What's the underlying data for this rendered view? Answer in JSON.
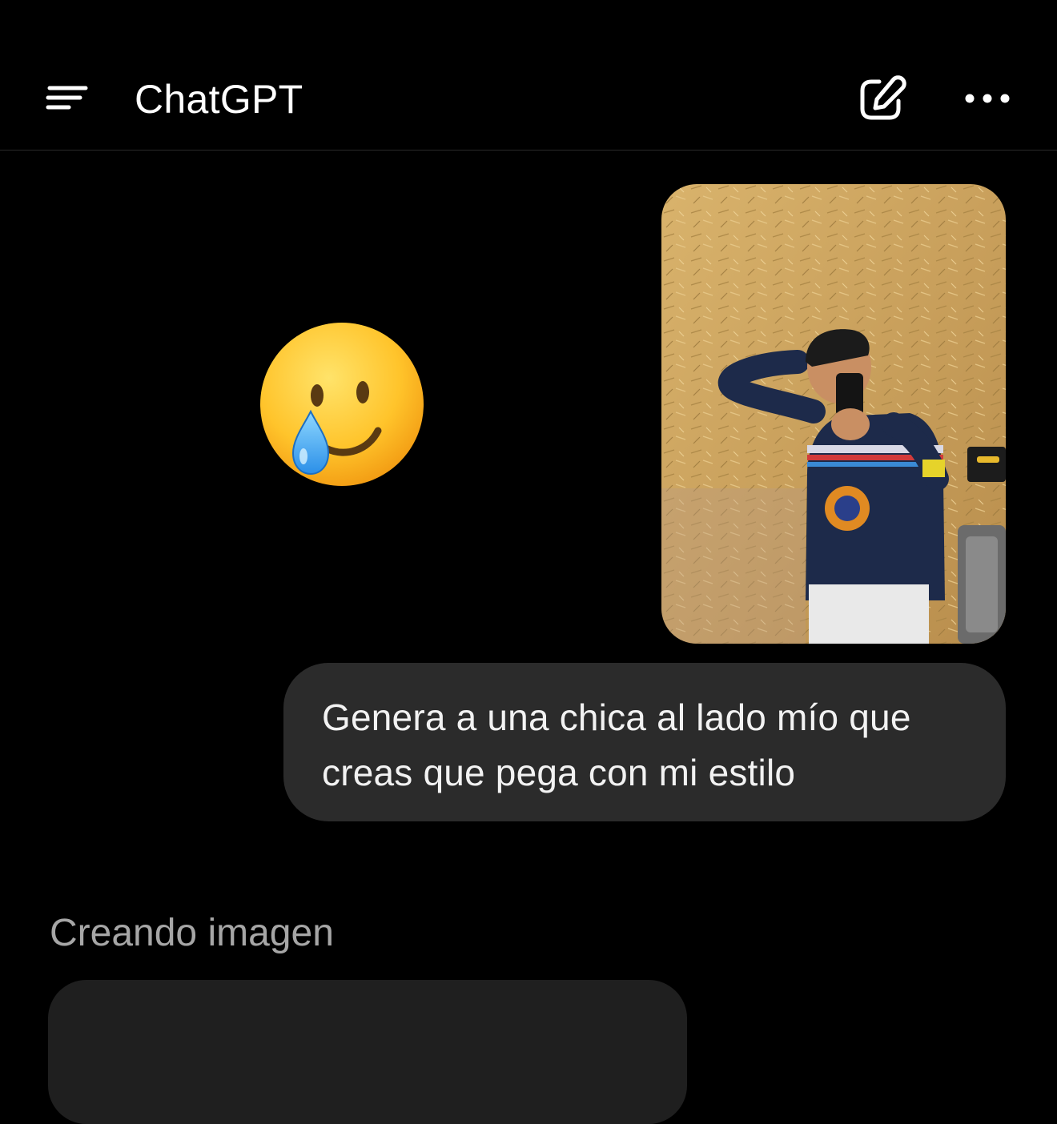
{
  "header": {
    "title": "ChatGPT",
    "menu_icon": "menu-icon",
    "new_chat_icon": "edit-icon",
    "more_icon": "ellipsis-icon"
  },
  "conversation": {
    "reaction_emoji": "smiling-face-with-tear",
    "user_image": {
      "subject": "mirror selfie"
    },
    "user_message": "Genera a una chica al lado mío que creas que pega con mi estilo",
    "assistant_status": "Creando imagen"
  },
  "colors": {
    "background": "#000000",
    "bubble": "#2b2b2b",
    "placeholder": "#1f1f1f",
    "status_text": "#a6a6a6"
  }
}
